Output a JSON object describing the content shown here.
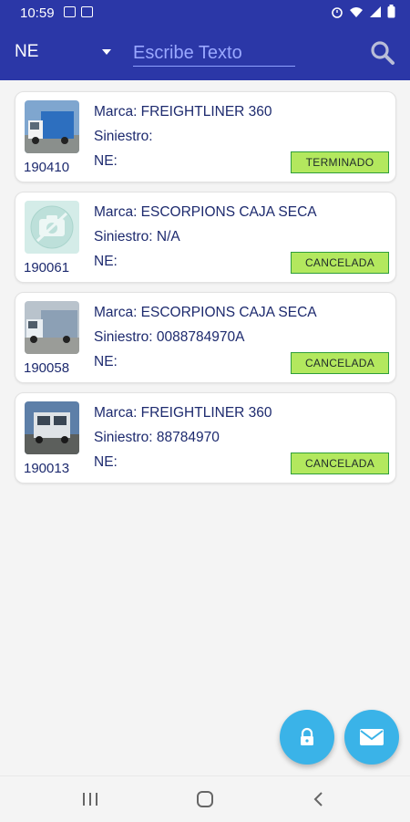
{
  "status_bar": {
    "time": "10:59"
  },
  "app_bar": {
    "filter_value": "NE",
    "search_placeholder": "Escribe Texto"
  },
  "records": [
    {
      "id": "190410",
      "marca": "Marca: FREIGHTLINER 360",
      "siniestro": "Siniestro:",
      "ne": "NE:",
      "status": "TERMINADO",
      "thumb": "truck-photo"
    },
    {
      "id": "190061",
      "marca": "Marca: ESCORPIONS CAJA SECA",
      "siniestro": "Siniestro: N/A",
      "ne": "NE:",
      "status": "CANCELADA",
      "thumb": "no-photo"
    },
    {
      "id": "190058",
      "marca": "Marca: ESCORPIONS CAJA SECA",
      "siniestro": "Siniestro: 0088784970A",
      "ne": "NE:",
      "status": "CANCELADA",
      "thumb": "truck-photo"
    },
    {
      "id": "190013",
      "marca": "Marca: FREIGHTLINER 360",
      "siniestro": "Siniestro: 88784970",
      "ne": "NE:",
      "status": "CANCELADA",
      "thumb": "truck-photo"
    }
  ],
  "colors": {
    "app_bar": "#2b37a7",
    "status_button": "#b3e85e",
    "fab": "#3ab3e8"
  }
}
